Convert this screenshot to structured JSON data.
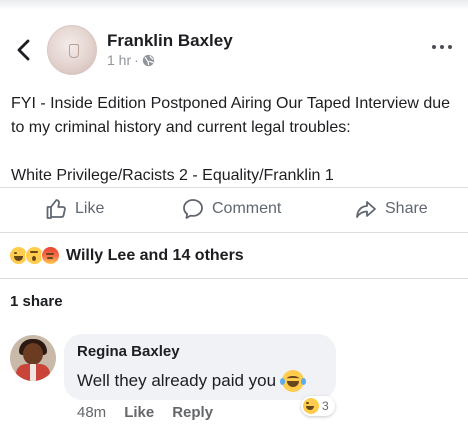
{
  "header": {
    "back_icon": "chevron-left-icon",
    "author": "Franklin Baxley",
    "time": "1 hr",
    "separator": "·",
    "privacy_icon": "globe-icon",
    "more_icon": "more-horizontal-icon"
  },
  "post": {
    "line1": "FYI - Inside Edition Postponed Airing Our Taped Interview due to my criminal history and current legal troubles:",
    "line2": "White Privilege/Racists 2 - Equality/Franklin 1"
  },
  "actions": {
    "like": "Like",
    "comment": "Comment",
    "share": "Share"
  },
  "reactions": {
    "summary": "Willy Lee and 14 others",
    "icons": [
      "laugh-emoji-icon",
      "wow-emoji-icon",
      "angry-emoji-icon"
    ]
  },
  "shares": {
    "label": "1 share"
  },
  "comment": {
    "author": "Regina Baxley",
    "text": "Well they already paid you",
    "time": "48m",
    "like": "Like",
    "reply": "Reply",
    "reaction_count": "3"
  },
  "colors": {
    "text": "#1c1e21",
    "secondary": "#606770",
    "divider": "#dadde1",
    "bubble": "#f0f2f5",
    "emoji_yellow": "#ffcc4d"
  }
}
